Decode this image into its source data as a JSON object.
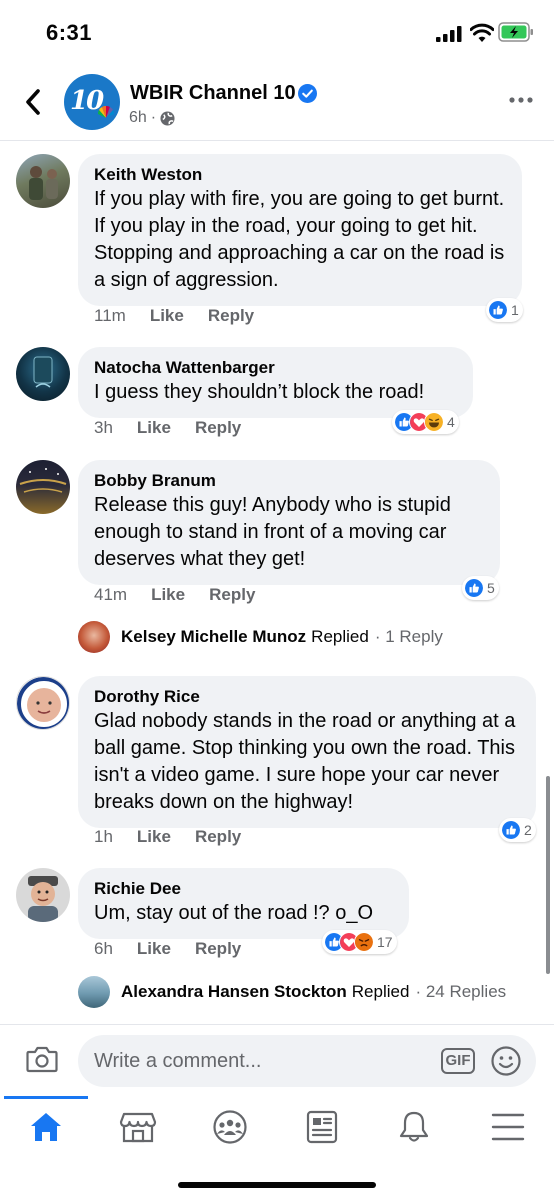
{
  "status_bar": {
    "time": "6:31"
  },
  "header": {
    "page_name": "WBIR Channel 10",
    "logo_text": "10",
    "time": "6h",
    "separator": "·"
  },
  "comments": [
    {
      "author": "Keith Weston",
      "text": "If you play with fire, you are going to get burnt. If you play in the road, your going to get hit. Stopping and approaching a car on the road is a sign of aggression.",
      "time": "11m",
      "like": "Like",
      "reply": "Reply",
      "reaction_count": "1"
    },
    {
      "author": "Natocha Wattenbarger",
      "text": "I guess they shouldn’t block the road!",
      "time": "3h",
      "like": "Like",
      "reply": "Reply",
      "reaction_count": "4"
    },
    {
      "author": "Bobby Branum",
      "text": "Release this guy! Anybody who is stupid enough to stand in front of a moving car deserves what they get!",
      "time": "41m",
      "like": "Like",
      "reply": "Reply",
      "reaction_count": "5"
    },
    {
      "author": "Dorothy Rice",
      "text": "Glad nobody stands in the road or anything at a ball game. Stop thinking you own the road. This isn't a video game. I sure hope your car never breaks down on the highway!",
      "time": "1h",
      "like": "Like",
      "reply": "Reply",
      "reaction_count": "2"
    },
    {
      "author": "Richie Dee",
      "text": "Um, stay out of the road !? o_O",
      "time": "6h",
      "like": "Like",
      "reply": "Reply",
      "reaction_count": "17"
    }
  ],
  "replies": [
    {
      "name": "Kelsey Michelle Munoz",
      "word": "Replied",
      "count": "· 1 Reply"
    },
    {
      "name": "Alexandra Hansen Stockton",
      "word": "Replied",
      "count": "· 24 Replies"
    }
  ],
  "composer": {
    "placeholder": "Write a comment...",
    "gif_label": "GIF"
  },
  "colors": {
    "accent": "#1877f2",
    "bubble": "#f0f2f5",
    "secondary_text": "#65676b",
    "love": "#f33e58",
    "haha": "#f7b125",
    "angry": "#e9710f"
  },
  "icons": [
    "back-arrow-icon",
    "verified-badge-icon",
    "globe-icon",
    "more-dots-icon",
    "like-reaction-icon",
    "love-reaction-icon",
    "haha-reaction-icon",
    "angry-reaction-icon",
    "camera-icon",
    "emoji-icon",
    "home-icon",
    "marketplace-icon",
    "groups-icon",
    "news-icon",
    "bell-icon",
    "menu-icon"
  ]
}
